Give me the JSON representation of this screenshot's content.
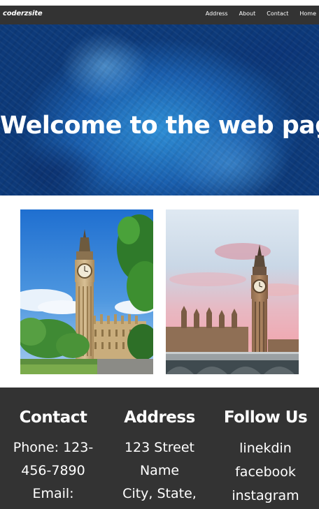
{
  "navbar": {
    "brand": "coderzsite",
    "links": [
      "Address",
      "About",
      "Contact",
      "Home"
    ]
  },
  "hero": {
    "title": "Welcome to the web page"
  },
  "footer": {
    "contact": {
      "heading": "Contact",
      "lines": [
        "Phone: 123-",
        "456-7890",
        "Email:"
      ]
    },
    "address": {
      "heading": "Address",
      "lines": [
        "123 Street",
        "Name",
        "City, State,"
      ]
    },
    "follow": {
      "heading": "Follow Us",
      "links": [
        "linekdin",
        "facebook",
        "instagram"
      ]
    }
  },
  "colors": {
    "navbar_bg": "#333333",
    "footer_bg": "#333333",
    "hero_blue": "#1a5fae"
  }
}
